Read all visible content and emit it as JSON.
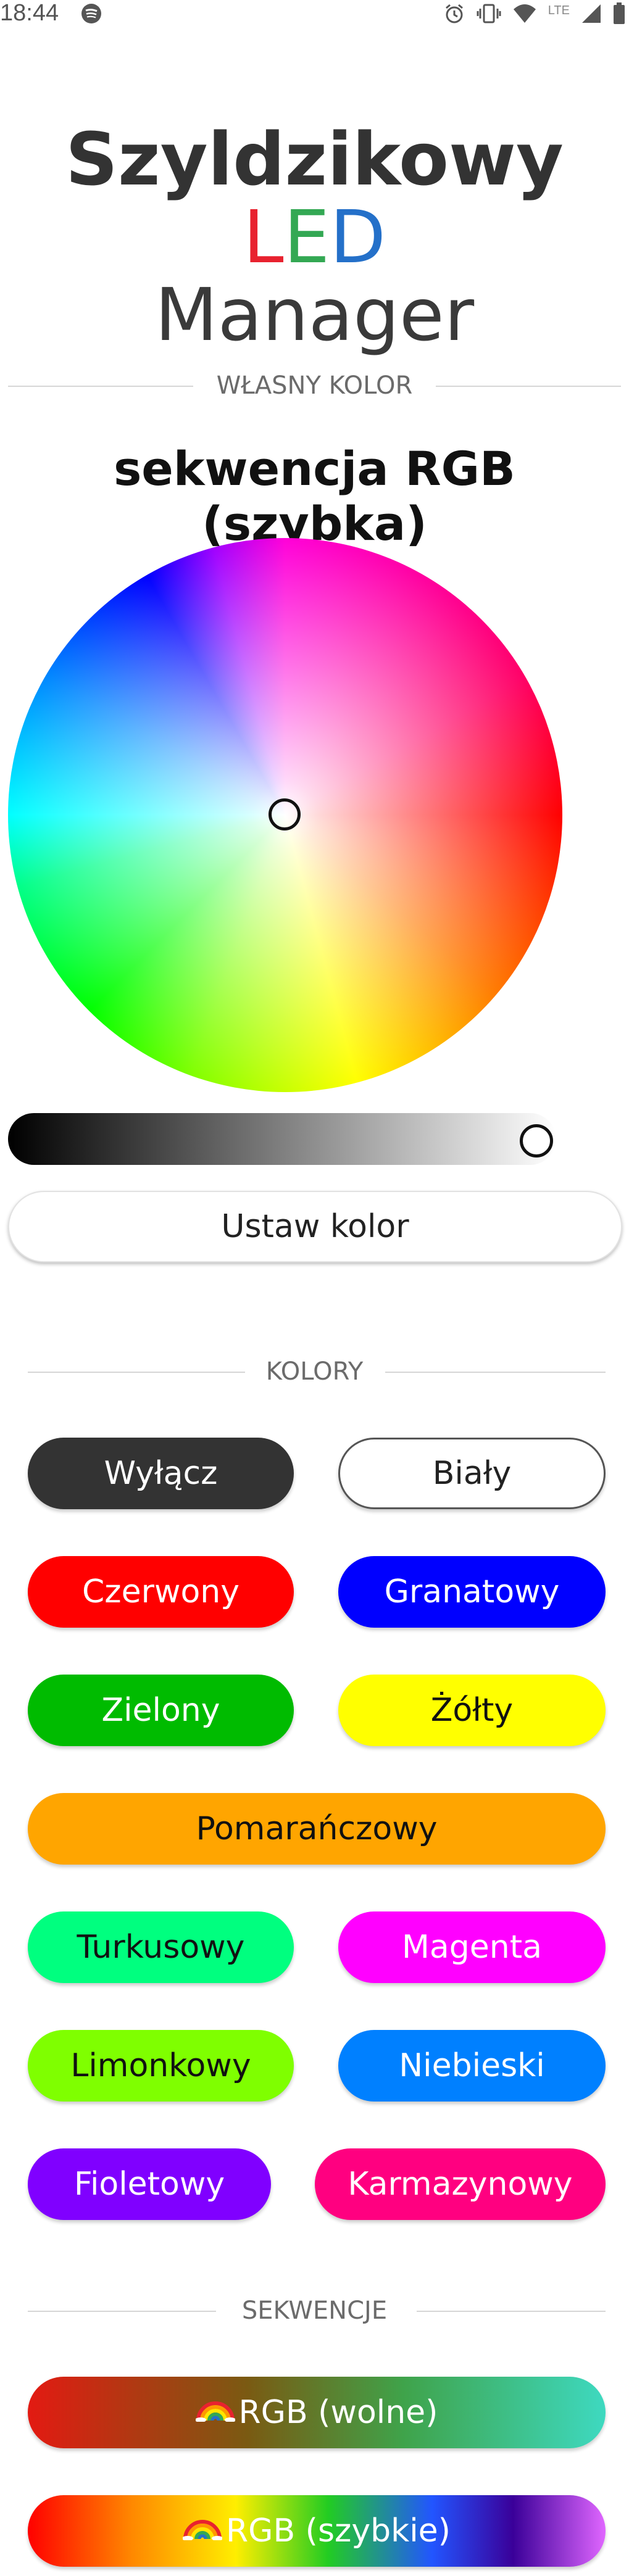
{
  "status_bar": {
    "time": "18:44",
    "network": "LTE",
    "icons": [
      "spotify-icon",
      "alarm-icon",
      "vibrate-icon",
      "wifi-icon",
      "signal-icon",
      "battery-icon"
    ]
  },
  "header": {
    "title_main": "Szyldzikowy ",
    "title_led_l": "L",
    "title_led_e": "E",
    "title_led_d": "D",
    "title_second": "Manager",
    "led_colors": [
      "#e8222f",
      "#33a853",
      "#2470c9"
    ]
  },
  "custom_color": {
    "section_label": "WŁASNY KOLOR",
    "current_mode": "sekwencja RGB (szybka)",
    "set_button": "Ustaw kolor",
    "brightness_level": 1.0
  },
  "colors": {
    "section_label": "KOLORY",
    "buttons": [
      {
        "label": "Wyłącz",
        "bg": "#333333",
        "fg": "#ffffff"
      },
      {
        "label": "Biały",
        "bg": "#ffffff",
        "fg": "#222222"
      },
      {
        "label": "Czerwony",
        "bg": "#ff0000",
        "fg": "#ffffff"
      },
      {
        "label": "Granatowy",
        "bg": "#0000ff",
        "fg": "#ffffff"
      },
      {
        "label": "Zielony",
        "bg": "#00bb00",
        "fg": "#ffffff"
      },
      {
        "label": "Żółty",
        "bg": "#ffff00",
        "fg": "#111111"
      },
      {
        "label": "Pomarańczowy",
        "bg": "#ffa500",
        "fg": "#111111"
      },
      {
        "label": "Turkusowy",
        "bg": "#00ff7f",
        "fg": "#111111"
      },
      {
        "label": "Magenta",
        "bg": "#ff00ff",
        "fg": "#ffffff"
      },
      {
        "label": "Limonkowy",
        "bg": "#7fff00",
        "fg": "#111111"
      },
      {
        "label": "Niebieski",
        "bg": "#0080ff",
        "fg": "#ffffff"
      },
      {
        "label": "Fioletowy",
        "bg": "#8000ff",
        "fg": "#ffffff"
      },
      {
        "label": "Karmazynowy",
        "bg": "#ff0080",
        "fg": "#ffffff"
      }
    ]
  },
  "sequences": {
    "section_label": "SEKWENCJE",
    "buttons": [
      {
        "label": "RGB (wolne)",
        "icon": "rainbow-icon"
      },
      {
        "label": "RGB (szybkie)",
        "icon": "rainbow-icon"
      }
    ]
  }
}
